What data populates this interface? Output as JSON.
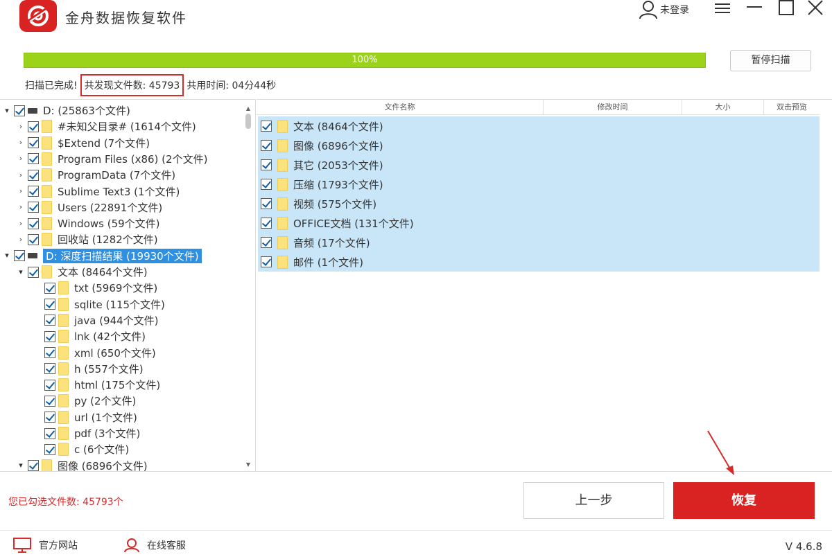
{
  "app": {
    "title": "金舟数据恢复软件",
    "accent": "#d92323",
    "progress_color": "#9ad31a"
  },
  "user": {
    "login_label": "未登录"
  },
  "scan": {
    "progress_fraction": 1.0,
    "progress_label": "100%",
    "pause_label": "暂停扫描",
    "status_done": "扫描已完成!",
    "found_label": "共发现文件数: 45793",
    "time_label": "共用时间: 04分44秒"
  },
  "tree": [
    {
      "label": "D:   (25863个文件)",
      "level": 0,
      "expanded": true,
      "type": "drive"
    },
    {
      "label": "#未知父目录#   (1614个文件)",
      "level": 1,
      "expanded": false,
      "type": "folder"
    },
    {
      "label": "$Extend   (7个文件)",
      "level": 1,
      "expanded": false,
      "type": "folder"
    },
    {
      "label": "Program Files (x86)   (2个文件)",
      "level": 1,
      "expanded": false,
      "type": "folder"
    },
    {
      "label": "ProgramData   (7个文件)",
      "level": 1,
      "expanded": false,
      "type": "folder"
    },
    {
      "label": "Sublime Text3   (1个文件)",
      "level": 1,
      "expanded": false,
      "type": "folder"
    },
    {
      "label": "Users   (22891个文件)",
      "level": 1,
      "expanded": false,
      "type": "folder"
    },
    {
      "label": "Windows   (59个文件)",
      "level": 1,
      "expanded": false,
      "type": "folder"
    },
    {
      "label": "回收站   (1282个文件)",
      "level": 1,
      "expanded": false,
      "type": "folder"
    },
    {
      "label": "D: 深度扫描结果   (19930个文件)",
      "level": 0,
      "expanded": true,
      "type": "drive",
      "selected": true
    },
    {
      "label": "文本   (8464个文件)",
      "level": 1,
      "expanded": true,
      "type": "folder"
    },
    {
      "label": "txt   (5969个文件)",
      "level": 2,
      "type": "folder"
    },
    {
      "label": "sqlite   (115个文件)",
      "level": 2,
      "type": "folder"
    },
    {
      "label": "java   (944个文件)",
      "level": 2,
      "type": "folder"
    },
    {
      "label": "lnk   (42个文件)",
      "level": 2,
      "type": "folder"
    },
    {
      "label": "xml   (650个文件)",
      "level": 2,
      "type": "folder"
    },
    {
      "label": "h   (557个文件)",
      "level": 2,
      "type": "folder"
    },
    {
      "label": "html   (175个文件)",
      "level": 2,
      "type": "folder"
    },
    {
      "label": "py   (2个文件)",
      "level": 2,
      "type": "folder"
    },
    {
      "label": "url   (1个文件)",
      "level": 2,
      "type": "folder"
    },
    {
      "label": "pdf   (3个文件)",
      "level": 2,
      "type": "folder"
    },
    {
      "label": "c   (6个文件)",
      "level": 2,
      "type": "folder"
    },
    {
      "label": "图像   (6896个文件)",
      "level": 1,
      "expanded": true,
      "type": "folder"
    }
  ],
  "list": {
    "columns": [
      "文件名称",
      "修改时间",
      "大小",
      "双击预览"
    ],
    "rows": [
      "文本   (8464个文件)",
      "图像   (6896个文件)",
      "其它   (2053个文件)",
      "压缩   (1793个文件)",
      "视频   (575个文件)",
      "OFFICE文档   (131个文件)",
      "音频   (17个文件)",
      "邮件   (1个文件)"
    ]
  },
  "bottom": {
    "selected_count": "您已勾选文件数: 45793个",
    "prev_label": "上一步",
    "recover_label": "恢复"
  },
  "footer": {
    "website_label": "官方网站",
    "support_label": "在线客服",
    "version": "V 4.6.8"
  }
}
